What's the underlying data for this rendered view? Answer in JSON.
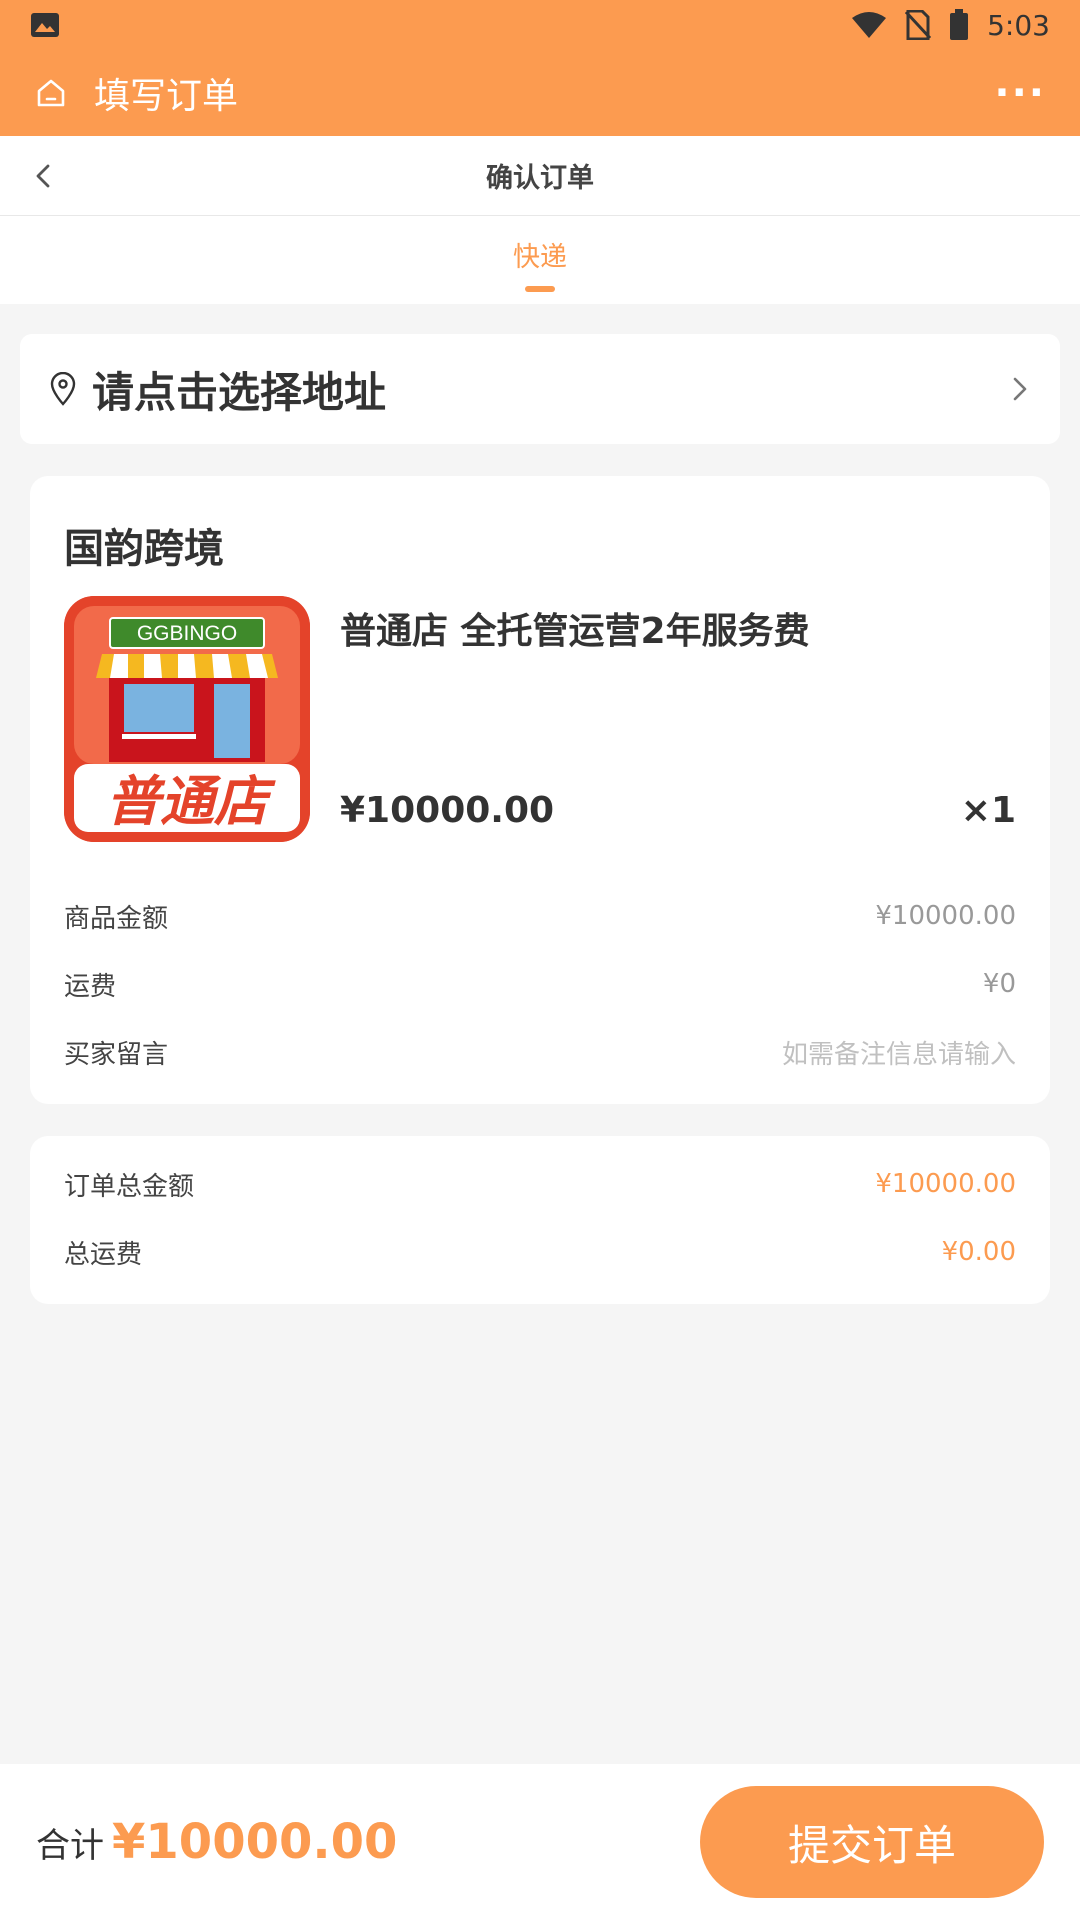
{
  "status_bar": {
    "time": "5:03",
    "icons": [
      "image-icon",
      "wifi-icon",
      "no-sim-icon",
      "battery-icon"
    ]
  },
  "app_bar": {
    "title": "填写订单",
    "home_icon": "home-icon",
    "more_label": "···"
  },
  "nav_bar": {
    "title": "确认订单",
    "back_icon": "chevron-left-icon"
  },
  "tabs": [
    {
      "label": "快递",
      "active": true
    }
  ],
  "address": {
    "text": "请点击选择地址",
    "location_icon": "location-pin-icon",
    "arrow_icon": "chevron-right-icon"
  },
  "order": {
    "store_name": "国韵跨境",
    "product": {
      "title": "普通店 全托管运营2年服务费",
      "price": "¥10000.00",
      "quantity": "×1",
      "image": {
        "sign_text": "GGBINGO",
        "caption": "普通店",
        "colors": {
          "background": "#e4432a",
          "sign": "#3f8a2b",
          "awning_yellow": "#f5b820",
          "shop": "#c9141c"
        }
      }
    },
    "fees": [
      {
        "label": "商品金额",
        "value": "¥10000.00"
      },
      {
        "label": "运费",
        "value": "¥0"
      }
    ],
    "message": {
      "label": "买家留言",
      "placeholder": "如需备注信息请输入"
    }
  },
  "summary": [
    {
      "label": "订单总金额",
      "value": "¥10000.00"
    },
    {
      "label": "总运费",
      "value": "¥0.00"
    }
  ],
  "footer": {
    "total_label": "合计",
    "total_amount": "¥10000.00",
    "submit_label": "提交订单"
  },
  "colors": {
    "accent": "#fc9b50",
    "background": "#f5f5f5",
    "card": "#ffffff"
  }
}
